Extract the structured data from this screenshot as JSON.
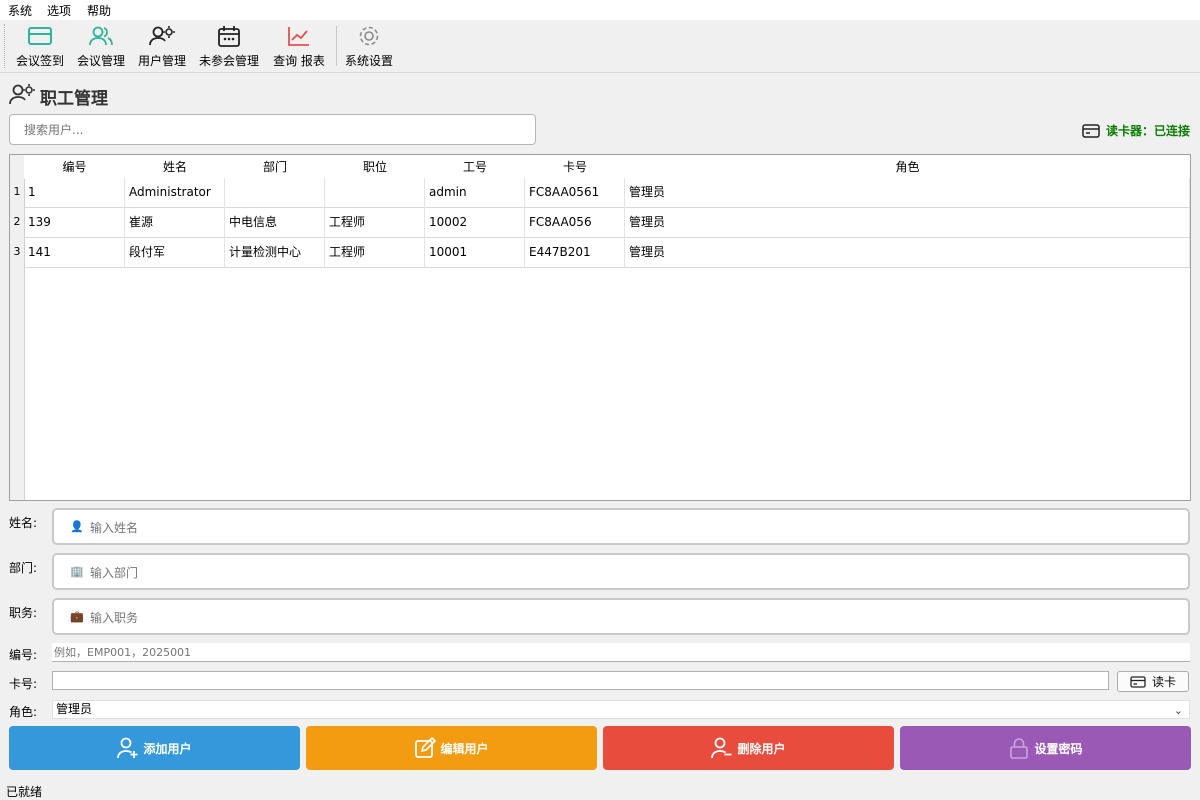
{
  "menu": [
    "系统",
    "选项",
    "帮助"
  ],
  "toolbar": [
    {
      "label": "会议签到",
      "icon": "card-icon",
      "color": "#2fb39a"
    },
    {
      "label": "会议管理",
      "icon": "users-icon",
      "color": "#2fb39a"
    },
    {
      "label": "用户管理",
      "icon": "user-gear-icon",
      "color": "#222222"
    },
    {
      "label": "未参会管理",
      "icon": "calendar-icon",
      "color": "#222222"
    },
    {
      "label": "查询 报表",
      "icon": "chart-icon",
      "color": "#e05050"
    },
    {
      "label": "系统设置",
      "icon": "gear-icon",
      "color": "#8a8a8a"
    }
  ],
  "page": {
    "title": "职工管理"
  },
  "search": {
    "placeholder": "搜索用户..."
  },
  "reader_status": "读卡器：已连接",
  "table": {
    "columns": [
      "编号",
      "姓名",
      "部门",
      "职位",
      "工号",
      "卡号",
      "角色"
    ],
    "rows": [
      {
        "n": "1",
        "cells": [
          "1",
          "Administrator",
          "",
          "",
          "admin",
          "FC8AA0561",
          "管理员"
        ]
      },
      {
        "n": "2",
        "cells": [
          "139",
          "崔源",
          "中电信息",
          "工程师",
          "10002",
          "FC8AA056",
          "管理员"
        ]
      },
      {
        "n": "3",
        "cells": [
          "141",
          "段付军",
          "计量检测中心",
          "工程师",
          "10001",
          "E447B201",
          "管理员"
        ]
      }
    ]
  },
  "form": {
    "name_label": "姓名:",
    "name_placeholder": "输入姓名",
    "dept_label": "部门:",
    "dept_placeholder": "输入部门",
    "position_label": "职务:",
    "position_placeholder": "输入职务",
    "number_label": "编号:",
    "number_placeholder": "例如，EMP001，2025001",
    "card_label": "卡号:",
    "card_value": "",
    "read_button": "读卡",
    "role_label": "角色:",
    "role_value": "管理员"
  },
  "actions": {
    "add": "添加用户",
    "edit": "编辑用户",
    "delete": "删除用户",
    "password": "设置密码"
  },
  "colors": {
    "add": "#3498db",
    "edit": "#f39c12",
    "delete": "#e74c3c",
    "password": "#9b59b6",
    "reader_ok": "#0a7d00"
  },
  "status": "已就绪"
}
